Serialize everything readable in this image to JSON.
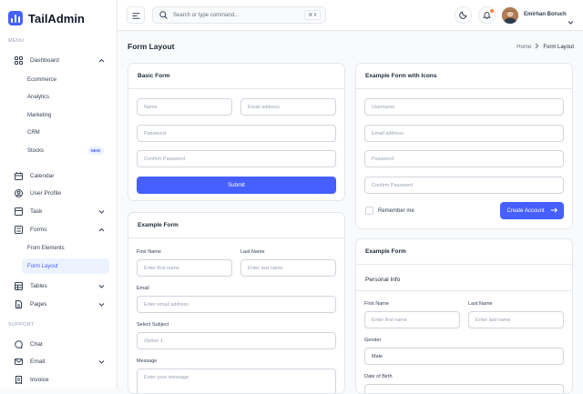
{
  "app": {
    "name": "TailAdmin"
  },
  "sidebar": {
    "menu_title": "MENU",
    "support_title": "SUPPORT",
    "items": [
      {
        "label": "Dashboard"
      },
      {
        "label": "Calendar"
      },
      {
        "label": "User Profile"
      },
      {
        "label": "Task"
      },
      {
        "label": "Forms"
      },
      {
        "label": "Tables"
      },
      {
        "label": "Pages"
      },
      {
        "label": "Chat"
      },
      {
        "label": "Email"
      },
      {
        "label": "Invoice"
      }
    ],
    "dashboard_sub": [
      "Ecommerce",
      "Analytics",
      "Marketing",
      "CRM",
      "Stocks"
    ],
    "stocks_badge": "NEW",
    "forms_sub": [
      "From Elements",
      "Form Layout"
    ]
  },
  "header": {
    "search_placeholder": "Search or type command...",
    "shortcut": "⌘ K",
    "user_name": "Emirhan Boruch"
  },
  "page": {
    "title": "Form Layout",
    "breadcrumb_home": "Home",
    "breadcrumb_current": "Form Layout"
  },
  "basic_form": {
    "title": "Basic Form",
    "name_placeholder": "Name",
    "email_placeholder": "Email address",
    "password_placeholder": "Password",
    "confirm_placeholder": "Confirm Password",
    "submit_label": "Submit"
  },
  "icon_form": {
    "title": "Example Form with Icons",
    "username_placeholder": "Username",
    "email_placeholder": "Email address",
    "password_placeholder": "Password",
    "confirm_placeholder": "Confirm Password",
    "remember_label": "Remember me",
    "create_label": "Create Account"
  },
  "example_form": {
    "title": "Example Form",
    "first_name_label": "First Name",
    "first_name_placeholder": "Enter first name",
    "last_name_label": "Last Name",
    "last_name_placeholder": "Enter last name",
    "email_label": "Email",
    "email_placeholder": "Enter email address",
    "subject_label": "Select Subject",
    "subject_value": "Option 1",
    "message_label": "Message",
    "message_placeholder": "Enter your message"
  },
  "example_form_2": {
    "title": "Example Form",
    "section_title": "Personal Info",
    "first_name_label": "First Name",
    "first_name_placeholder": "Enter first name",
    "last_name_label": "Last Name",
    "last_name_placeholder": "Enter last name",
    "gender_label": "Gender",
    "gender_value": "Male",
    "dob_label": "Date of Birth"
  }
}
